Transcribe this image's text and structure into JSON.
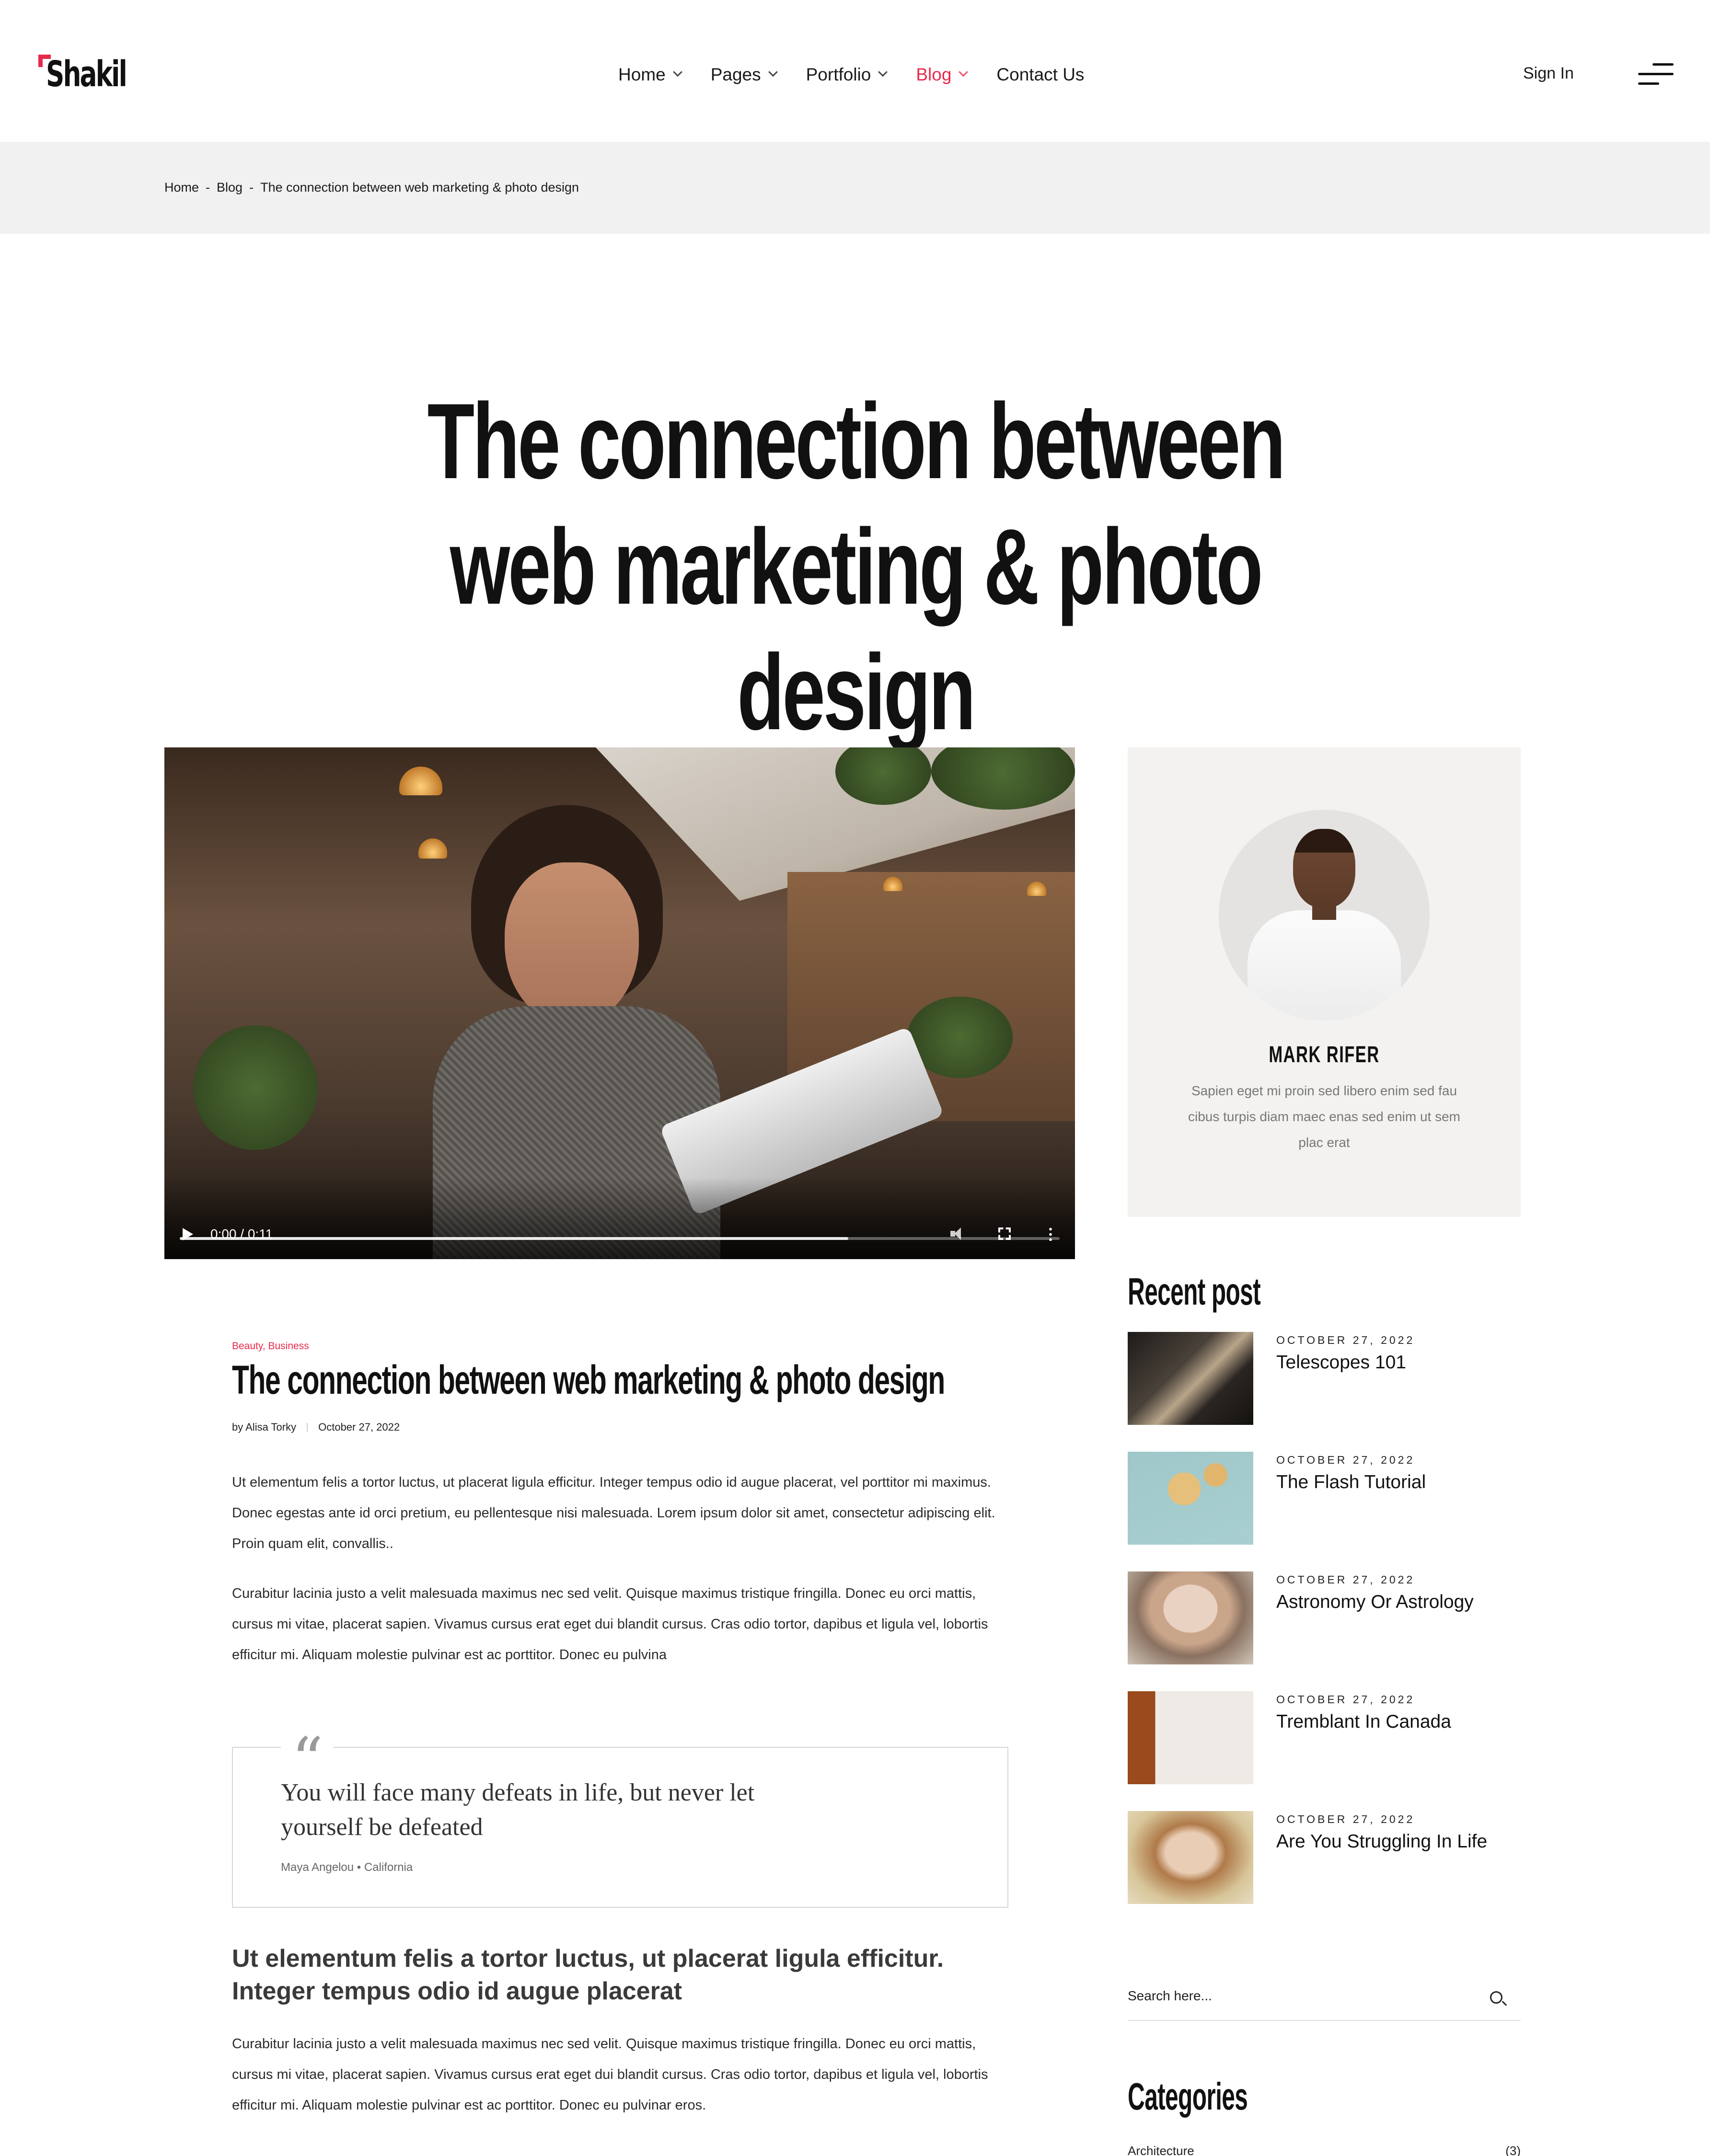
{
  "brand": {
    "logo_text": "Shakil",
    "accent": "#e8294a"
  },
  "nav": {
    "items": [
      {
        "label": "Home",
        "has_dropdown": true,
        "active": false
      },
      {
        "label": "Pages",
        "has_dropdown": true,
        "active": false
      },
      {
        "label": "Portfolio",
        "has_dropdown": true,
        "active": false
      },
      {
        "label": "Blog",
        "has_dropdown": true,
        "active": true
      },
      {
        "label": "Contact Us",
        "has_dropdown": false,
        "active": false
      }
    ],
    "sign_in": "Sign In",
    "menu_icon": "hamburger-icon"
  },
  "breadcrumb": {
    "items": [
      "Home",
      "Blog",
      "The connection between web marketing & photo design"
    ],
    "separator": "-"
  },
  "page_title": "The connection between web marketing & photo design",
  "video": {
    "time": "0:00 / 0:11",
    "progress": 0.76,
    "icons": [
      "play-icon",
      "volume-icon",
      "fullscreen-icon",
      "more-options-icon"
    ]
  },
  "article": {
    "categories": "Beauty, Business",
    "title": "The connection between web marketing & photo design",
    "author": "by Alisa Torky",
    "date": "October 27, 2022",
    "paragraph_1": "Ut elementum felis a tortor luctus, ut placerat ligula efficitur. Integer tempus odio id augue placerat, vel porttitor mi maximus. Donec egestas ante id orci pretium, eu pellentesque nisi malesuada. Lorem ipsum dolor sit amet, consectetur adipiscing elit. Proin quam elit, convallis..",
    "paragraph_2": "Curabitur lacinia justo a velit malesuada maximus nec sed velit. Quisque maximus tristique fringilla. Donec eu orci mattis, cursus mi vitae, placerat sapien. Vivamus cursus erat eget dui blandit cursus. Cras odio tortor, dapibus et ligula vel, lobortis efficitur mi. Aliquam molestie pulvinar est ac porttitor. Donec eu pulvina",
    "quote": {
      "mark": "“",
      "text": "You will face many defeats in life, but never let yourself be defeated",
      "cite": "Maya Angelou • California"
    },
    "subheading": "Ut elementum felis a tortor luctus, ut placerat ligula efficitur. Integer tempus odio id augue placerat",
    "paragraph_3": "Curabitur lacinia justo a velit malesuada maximus nec sed velit. Quisque maximus tristique fringilla. Donec eu orci mattis, cursus mi vitae, placerat sapien. Vivamus cursus erat eget dui blandit cursus. Cras odio tortor, dapibus et ligula vel, lobortis efficitur mi. Aliquam molestie pulvinar est ac porttitor. Donec eu pulvinar eros."
  },
  "sidebar": {
    "author": {
      "name": "MARK RIFER",
      "bio": "Sapien eget mi proin sed libero enim sed fau cibus turpis diam maec enas sed enim ut sem plac erat"
    },
    "recent_heading": "Recent post",
    "recent_posts": [
      {
        "date": "OCTOBER 27, 2022",
        "title": "Telescopes 101"
      },
      {
        "date": "OCTOBER 27, 2022",
        "title": "The Flash Tutorial"
      },
      {
        "date": "OCTOBER 27, 2022",
        "title": "Astronomy Or Astrology"
      },
      {
        "date": "OCTOBER 27, 2022",
        "title": "Tremblant In Canada"
      },
      {
        "date": "OCTOBER 27, 2022",
        "title": "Are You Struggling In Life"
      }
    ],
    "search_placeholder": "Search here...",
    "categories_heading": "Categories",
    "categories": [
      {
        "name": "Architecture",
        "count": "(3)"
      }
    ]
  }
}
